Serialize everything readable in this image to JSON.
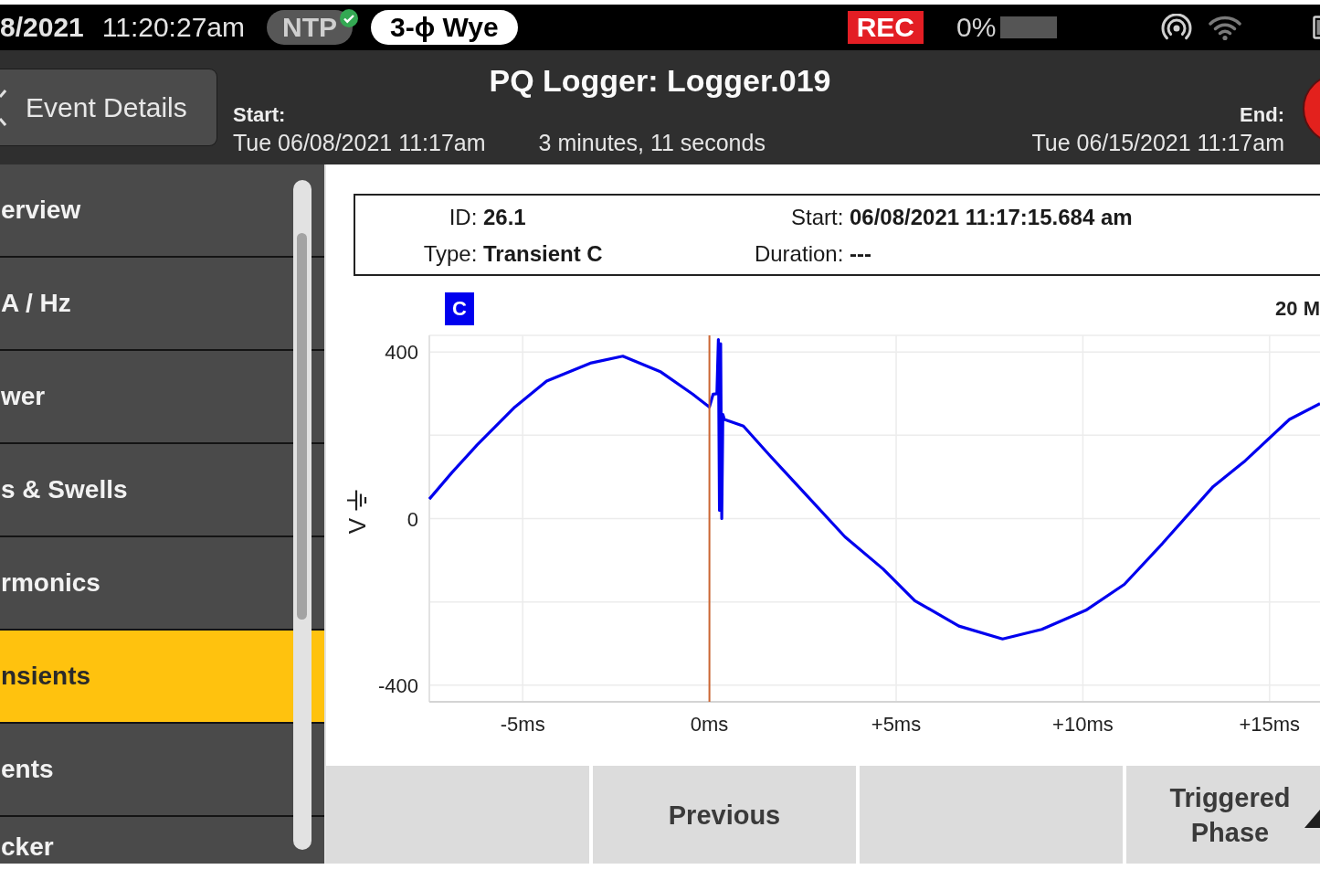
{
  "status_bar": {
    "date": "8/2021",
    "time": "11:20:27am",
    "ntp": {
      "label": "NTP",
      "synced": true
    },
    "wiring": "3-ϕ Wye",
    "recording": "REC",
    "storage": {
      "reading": "0%",
      "level": 0
    }
  },
  "header": {
    "back_button": "Event Details",
    "title": "PQ Logger: Logger.019",
    "start": {
      "label": "Start:",
      "value": "Tue 06/08/2021 11:17am"
    },
    "elapsed": "3 minutes, 11 seconds",
    "end": {
      "label": "End:",
      "value": "Tue 06/15/2021 11:17am"
    }
  },
  "sidebar": {
    "items": [
      {
        "label": "erview",
        "selected": false
      },
      {
        "label": "A / Hz",
        "selected": false
      },
      {
        "label": "wer",
        "selected": false
      },
      {
        "label": "s & Swells",
        "selected": false
      },
      {
        "label": "rmonics",
        "selected": false
      },
      {
        "label": "nsients",
        "selected": true
      },
      {
        "label": "ents",
        "selected": false
      },
      {
        "label": "cker",
        "selected": false
      }
    ]
  },
  "event": {
    "fields": [
      {
        "text": "ID: **26.1**"
      },
      {
        "text": "Start: **06/08/2021 11:17:15.684 am**"
      },
      {
        "text": "Type: **Transient C**"
      },
      {
        "text": "Duration: **---**"
      }
    ]
  },
  "waveform": {
    "right_label": "20 M",
    "chart_data": {
      "type": "line",
      "ylabel": "V",
      "x": [
        -7.5,
        -6.9,
        -6.22,
        -5.21,
        -4.36,
        -3.16,
        -2.32,
        -1.3,
        -0.45,
        0.0,
        0.1,
        0.2,
        0.24,
        0.27,
        0.3,
        0.33,
        0.36,
        0.4,
        0.91,
        1.59,
        2.61,
        3.63,
        4.65,
        5.5,
        6.68,
        7.85,
        8.9,
        10.08,
        11.11,
        12.13,
        13.49,
        14.35,
        15.53,
        16.35
      ],
      "series": [
        {
          "name": "C",
          "color": "#0000ee",
          "values": [
            47,
            110,
            177,
            268,
            330,
            374,
            390,
            352,
            299,
            268,
            299,
            300,
            430,
            20,
            420,
            0,
            250,
            238,
            222,
            154,
            55,
            -44,
            -121,
            -197,
            -258,
            -289,
            -266,
            -220,
            -158,
            -60,
            77,
            139,
            238,
            276
          ]
        }
      ],
      "xlim": [
        -7.5,
        16.35
      ],
      "ylim": [
        -440,
        440
      ],
      "xticks": [
        {
          "value": -5,
          "label": "-5ms"
        },
        {
          "value": 0,
          "label": "0ms"
        },
        {
          "value": 5,
          "label": "+5ms"
        },
        {
          "value": 10,
          "label": "+10ms"
        },
        {
          "value": 15,
          "label": "+15ms"
        }
      ],
      "yticks": [
        -400,
        0,
        400
      ],
      "grid": true,
      "ref_lines": [
        {
          "axis": "x",
          "value": 0,
          "color": "#cc6633"
        }
      ]
    }
  },
  "softkeys": [
    {
      "kind": "blank"
    },
    {
      "kind": "text",
      "label": "Previous"
    },
    {
      "kind": "blank"
    },
    {
      "kind": "menu",
      "label": "Triggered Phase"
    }
  ]
}
